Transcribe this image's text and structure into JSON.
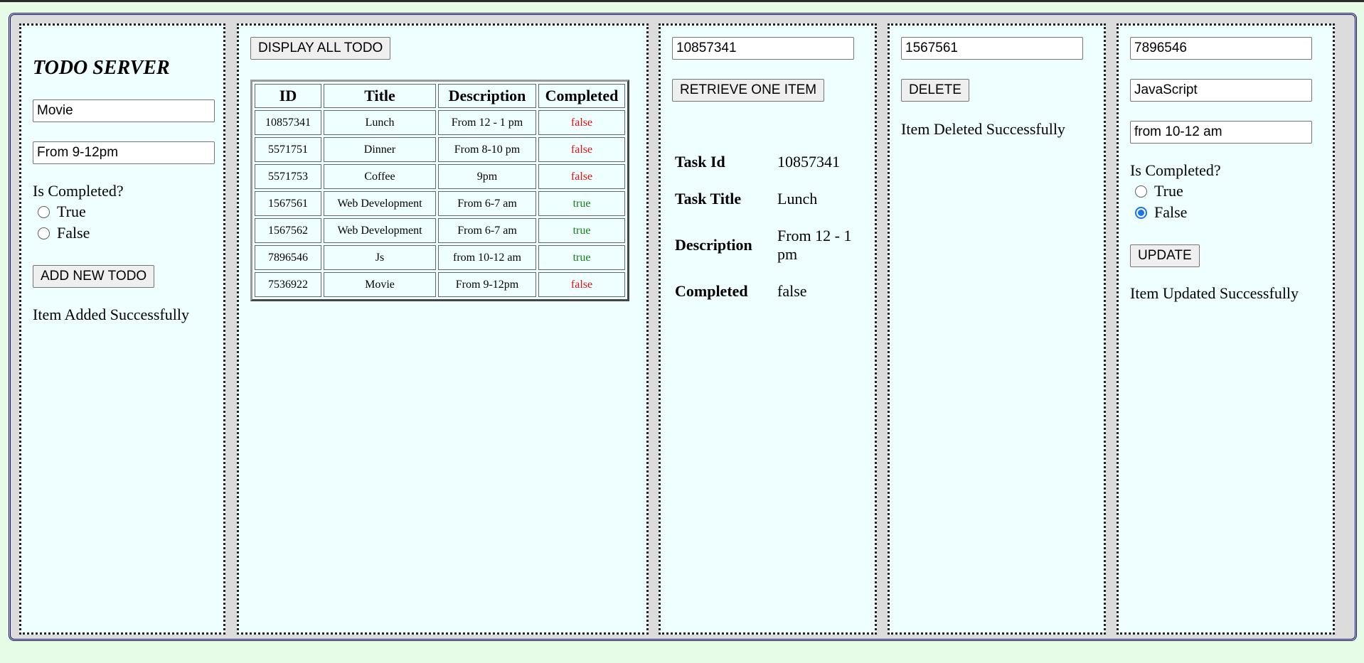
{
  "app": {
    "title": "TODO SERVER"
  },
  "add_panel": {
    "title_value": "Movie",
    "description_value": "From 9-12pm",
    "completed_label": "Is Completed?",
    "option_true": "True",
    "option_false": "False",
    "selected": "none",
    "button": "ADD NEW TODO",
    "message": "Item Added Successfully"
  },
  "list_panel": {
    "button": "DISPLAY ALL TODO",
    "columns": [
      "ID",
      "Title",
      "Description",
      "Completed"
    ],
    "rows": [
      {
        "id": "10857341",
        "title": "Lunch",
        "description": "From 12 - 1 pm",
        "completed": "false"
      },
      {
        "id": "5571751",
        "title": "Dinner",
        "description": "From 8-10 pm",
        "completed": "false"
      },
      {
        "id": "5571753",
        "title": "Coffee",
        "description": "9pm",
        "completed": "false"
      },
      {
        "id": "1567561",
        "title": "Web Development",
        "description": "From 6-7 am",
        "completed": "true"
      },
      {
        "id": "1567562",
        "title": "Web Development",
        "description": "From 6-7 am",
        "completed": "true"
      },
      {
        "id": "7896546",
        "title": "Js",
        "description": "from 10-12 am",
        "completed": "true"
      },
      {
        "id": "7536922",
        "title": "Movie",
        "description": "From 9-12pm",
        "completed": "false"
      }
    ],
    "colors": {
      "false": "#e01010",
      "true": "#108010"
    }
  },
  "retrieve_panel": {
    "id_value": "10857341",
    "button": "RETRIEVE ONE ITEM",
    "labels": {
      "id": "Task Id",
      "title": "Task Title",
      "description": "Description",
      "completed": "Completed"
    },
    "values": {
      "id": "10857341",
      "title": "Lunch",
      "description": "From 12 - 1 pm",
      "completed": "false"
    }
  },
  "delete_panel": {
    "id_value": "1567561",
    "button": "DELETE",
    "message": "Item Deleted Successfully"
  },
  "update_panel": {
    "id_value": "7896546",
    "title_value": "JavaScript",
    "description_value": "from 10-12 am",
    "completed_label": "Is Completed?",
    "option_true": "True",
    "option_false": "False",
    "selected": "false",
    "button": "UPDATE",
    "message": "Item Updated Successfully"
  }
}
